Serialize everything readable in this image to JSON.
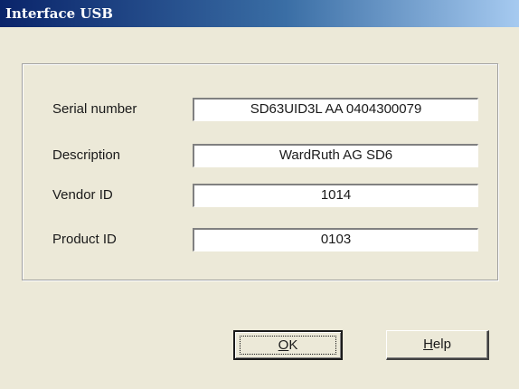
{
  "window": {
    "title": "Interface USB"
  },
  "fields": [
    {
      "label": "Serial number",
      "value": "SD63UID3L AA  0404300079"
    },
    {
      "label": "Description",
      "value": "WardRuth AG  SD6"
    },
    {
      "label": "Vendor ID",
      "value": "1014"
    },
    {
      "label": "Product ID",
      "value": "0103"
    }
  ],
  "buttons": {
    "ok_mnemonic": "O",
    "ok_rest": "K",
    "help_mnemonic": "H",
    "help_rest": "elp"
  }
}
